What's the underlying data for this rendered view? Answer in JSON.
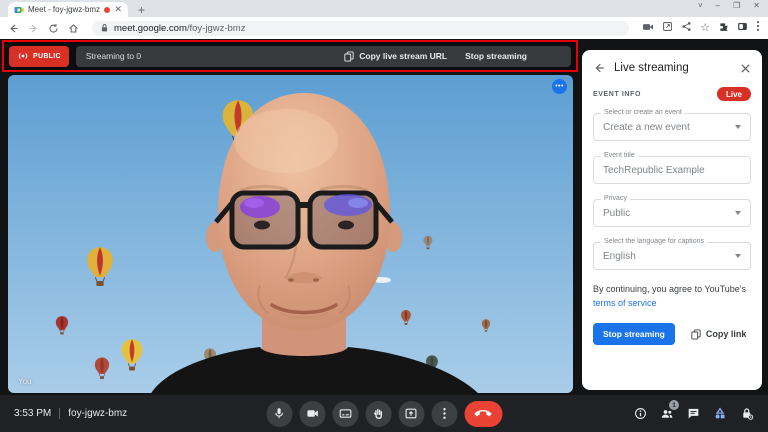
{
  "browser": {
    "tab_title": "Meet - foy-jgwz-bmz",
    "url_domain": "meet.google.com",
    "url_path": "/foy-jgwz-bmz"
  },
  "banner": {
    "public_label": "PUBLIC",
    "status": "Streaming to 0",
    "copy_url_label": "Copy live stream URL",
    "stop_label": "Stop streaming"
  },
  "video": {
    "you_label": "You",
    "more_glyph": "•••"
  },
  "sidebar": {
    "title": "Live streaming",
    "event_info_label": "EVENT INFO",
    "live_label": "Live",
    "fields": [
      {
        "label": "Select or create an event",
        "value": "Create a new event"
      },
      {
        "label": "Event title",
        "value": "TechRepublic Example"
      },
      {
        "label": "Privacy",
        "value": "Public"
      },
      {
        "label": "Select the language for captions",
        "value": "English"
      }
    ],
    "terms_prefix": "By continuing, you agree to YouTube's ",
    "terms_link": "terms of service",
    "stop_button_label": "Stop streaming",
    "copy_link_label": "Copy link"
  },
  "bottombar": {
    "time": "3:53 PM",
    "meeting_code": "foy-jgwz-bmz",
    "people_badge": "1"
  },
  "colors": {
    "accent_blue": "#1a73e8",
    "live_red": "#d93025",
    "annotation_red": "#e60000",
    "end_call_red": "#ea4335",
    "activities_blue": "#8ab4f8"
  }
}
